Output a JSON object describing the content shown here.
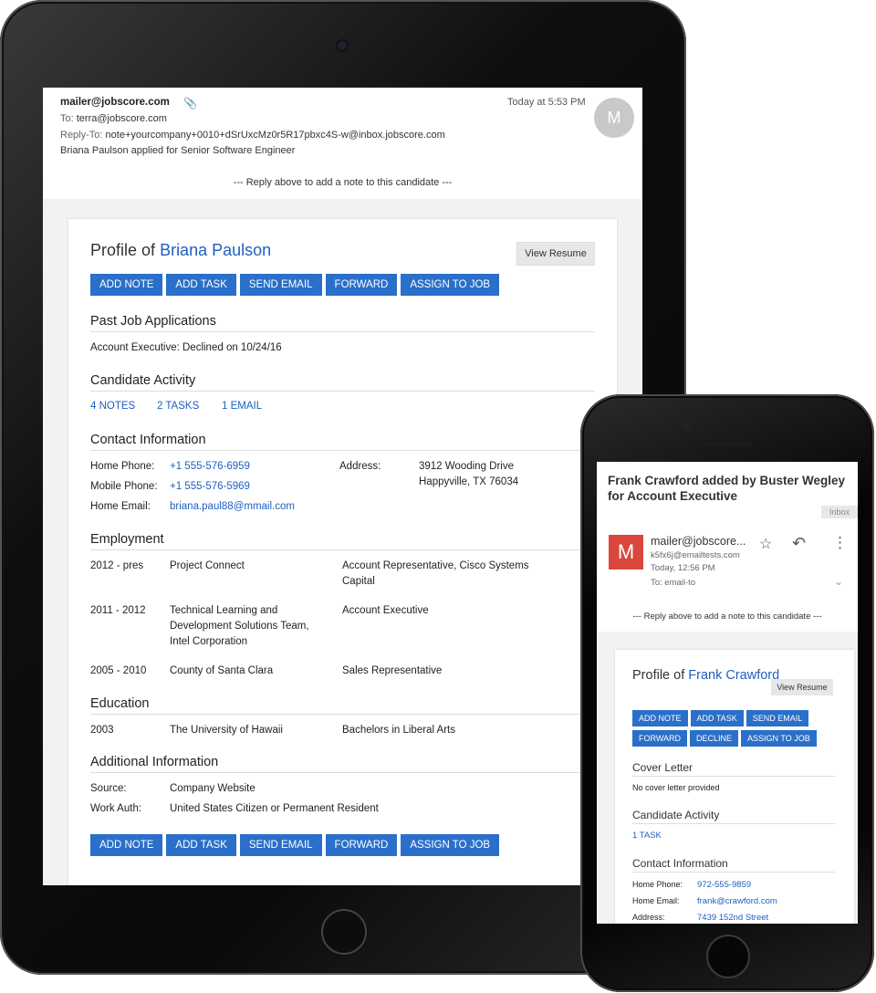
{
  "tablet": {
    "email": {
      "from": "mailer@jobscore.com",
      "date": "Today at 5:53 PM",
      "to_label": "To:",
      "to": "terra@jobscore.com",
      "reply_to_label": "Reply-To:",
      "reply_to": "note+yourcompany+0010+dSrUxcMz0r5R17pbxc4S-w@inbox.jobscore.com",
      "subject": "Briana Paulson applied for Senior Software Engineer",
      "avatar_initial": "M",
      "reply_note": "--- Reply above to add a note to this candidate ---"
    },
    "profile": {
      "title_prefix": "Profile of",
      "name": "Briana Paulson",
      "view_resume": "View Resume",
      "actions": [
        "ADD NOTE",
        "ADD TASK",
        "SEND EMAIL",
        "FORWARD",
        "ASSIGN TO JOB"
      ],
      "past_jobs": {
        "heading": "Past Job Applications",
        "entry": "Account Executive: Declined on 10/24/16"
      },
      "activity": {
        "heading": "Candidate Activity",
        "notes": "4 NOTES",
        "tasks": "2 TASKS",
        "emails": "1 EMAIL"
      },
      "contact": {
        "heading": "Contact Information",
        "home_phone_label": "Home Phone:",
        "home_phone": "+1 555-576-6959",
        "mobile_phone_label": "Mobile Phone:",
        "mobile_phone": "+1 555-576-5969",
        "home_email_label": "Home Email:",
        "home_email": "briana.paul88@mmail.com",
        "address_label": "Address:",
        "address_line1": "3912 Wooding Drive",
        "address_line2": "Happyville, TX 76034"
      },
      "employment": {
        "heading": "Employment",
        "rows": [
          {
            "years": "2012 - pres",
            "org": "Project Connect",
            "role": "Account Representative, Cisco Systems Capital"
          },
          {
            "years": "2011 - 2012",
            "org": "Technical Learning and Development Solutions Team, Intel Corporation",
            "role": "Account Executive"
          },
          {
            "years": "2005 - 2010",
            "org": "County of Santa Clara",
            "role": "Sales Representative"
          }
        ]
      },
      "education": {
        "heading": "Education",
        "year": "2003",
        "school": "The University of Hawaii",
        "degree": "Bachelors in Liberal Arts"
      },
      "additional": {
        "heading": "Additional Information",
        "source_label": "Source:",
        "source": "Company Website",
        "work_auth_label": "Work Auth:",
        "work_auth": "United States Citizen or Permanent Resident"
      }
    }
  },
  "phone": {
    "subject": "Frank Crawford added by Buster Wegley for Account Executive",
    "inbox_label": "Inbox",
    "avatar_initial": "M",
    "from": "mailer@jobscore...",
    "from_address": "k5fx6j@emailtests.com",
    "time": "Today, 12:56 PM",
    "to": "To: email-to",
    "reply_note": "--- Reply above to add a note to this candidate ---",
    "profile": {
      "title_prefix": "Profile of",
      "name": "Frank Crawford",
      "view_resume": "View Resume",
      "actions_row1": [
        "ADD NOTE",
        "ADD TASK",
        "SEND EMAIL"
      ],
      "actions_row2": [
        "FORWARD",
        "DECLINE",
        "ASSIGN TO JOB"
      ],
      "cover_letter_heading": "Cover Letter",
      "cover_letter_text": "No cover letter provided",
      "activity_heading": "Candidate Activity",
      "activity_tasks": "1 TASK",
      "contact_heading": "Contact Information",
      "home_phone_label": "Home Phone:",
      "home_phone": "972-555-9859",
      "home_email_label": "Home Email:",
      "home_email": "frank@crawford.com",
      "address_label": "Address:",
      "address": "7439 152nd Street"
    }
  }
}
